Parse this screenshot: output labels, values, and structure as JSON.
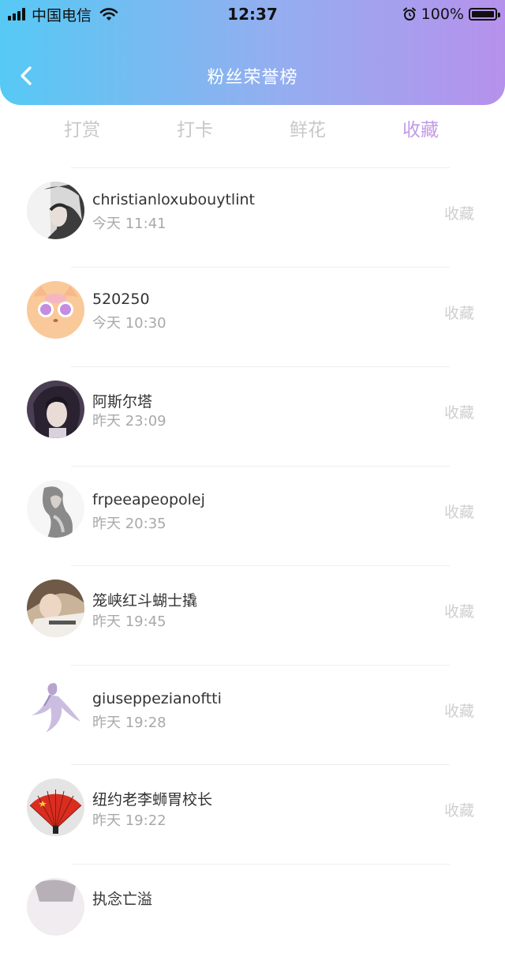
{
  "status_bar": {
    "carrier": "中国电信",
    "time": "12:37",
    "battery": "100%"
  },
  "header": {
    "title": "粉丝荣誉榜"
  },
  "tabs": [
    {
      "label": "打赏",
      "active": false
    },
    {
      "label": "打卡",
      "active": false
    },
    {
      "label": "鲜花",
      "active": false
    },
    {
      "label": "收藏",
      "active": true
    }
  ],
  "list": [
    {
      "name": "christianloxubouytlint",
      "time": "今天 11:41",
      "tag": "收藏"
    },
    {
      "name": "520250",
      "time": "今天 10:30",
      "tag": "收藏"
    },
    {
      "name": "阿斯尔塔",
      "time": "昨天 23:09",
      "tag": "收藏"
    },
    {
      "name": "frpeeapeopolej",
      "time": "昨天 20:35",
      "tag": "收藏"
    },
    {
      "name": "笼峡红斗蝴士撬",
      "time": "昨天 19:45",
      "tag": "收藏"
    },
    {
      "name": "giuseppezianoftti",
      "time": "昨天 19:28",
      "tag": "收藏"
    },
    {
      "name": "纽约老李蛳胃校长",
      "time": "昨天 19:22",
      "tag": "收藏"
    },
    {
      "name": "执念亡溢",
      "time": "",
      "tag": ""
    }
  ],
  "colors": {
    "header_gradient_start": "#56c9f4",
    "header_gradient_end": "#b691ec",
    "active_tab": "#c39ae8",
    "inactive_tab": "#c8c8c8"
  }
}
